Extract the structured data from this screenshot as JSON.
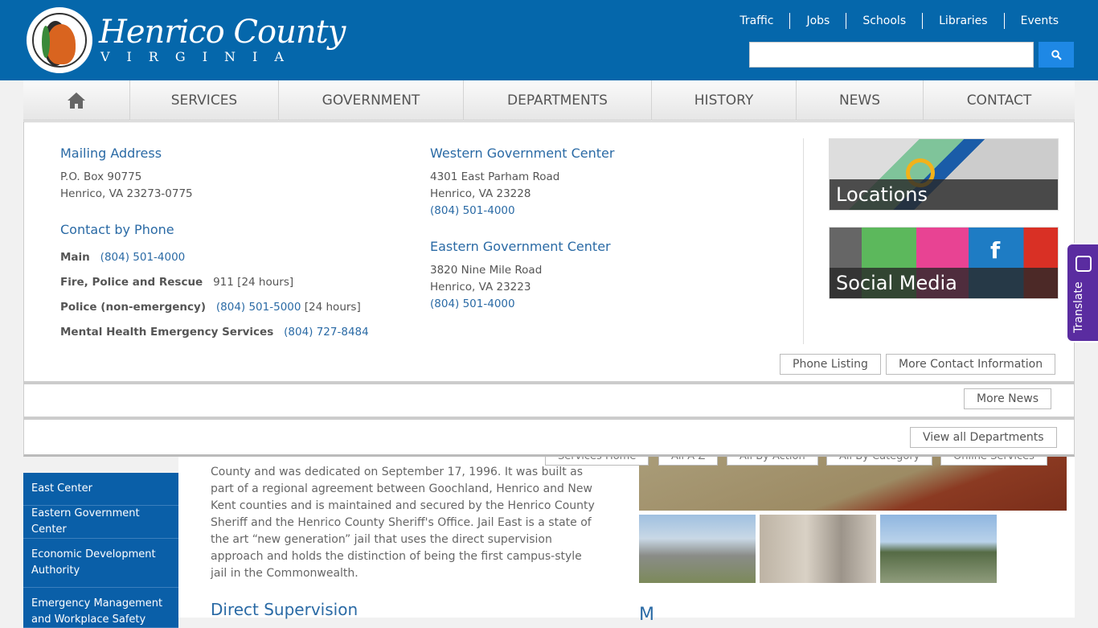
{
  "header": {
    "logo_title": "Henrico County",
    "logo_subtitle": "VIRGINIA",
    "seal_text": "County of Henrico, Virginia",
    "top_links": [
      "Traffic",
      "Jobs",
      "Schools",
      "Libraries",
      "Events"
    ],
    "search_placeholder": "",
    "search_icon": "search-icon"
  },
  "nav": {
    "home_icon": "home-icon",
    "items": [
      "SERVICES",
      "GOVERNMENT",
      "DEPARTMENTS",
      "HISTORY",
      "NEWS",
      "CONTACT"
    ]
  },
  "contact": {
    "mailing": {
      "title": "Mailing Address",
      "line1": "P.O. Box 90775",
      "line2": "Henrico, VA 23273-0775"
    },
    "phone": {
      "title": "Contact by Phone",
      "rows": [
        {
          "label": "Main",
          "number": "(804) 501-4000",
          "note": ""
        },
        {
          "label": "Fire, Police and Rescue",
          "number": "911",
          "note": "[24 hours]"
        },
        {
          "label": "Police (non-emergency)",
          "number": "(804) 501-5000",
          "note": "[24 hours]"
        },
        {
          "label": "Mental Health Emergency Services",
          "number": "(804) 727-8484",
          "note": ""
        }
      ]
    },
    "western": {
      "title": "Western Government Center",
      "line1": "4301 East Parham Road",
      "line2": "Henrico, VA 23228",
      "phone": "(804) 501-4000"
    },
    "eastern": {
      "title": "Eastern Government Center",
      "line1": "3820 Nine Mile Road",
      "line2": "Henrico, VA 23223",
      "phone": "(804) 501-4000"
    },
    "tiles": [
      "Locations",
      "Social Media"
    ],
    "buttons": [
      "Phone Listing",
      "More Contact Information"
    ]
  },
  "news": {
    "more_button": "More News"
  },
  "departments": {
    "view_all_button": "View all Departments"
  },
  "services_buttons": [
    "Services Home",
    "All A-Z",
    "All By Action",
    "All By Category",
    "Online Services"
  ],
  "sidebar": [
    "East Center",
    "Eastern Government Center",
    "Economic Development Authority",
    "Emergency Management and Workplace Safety"
  ],
  "main": {
    "text": "County and was dedicated on September 17, 1996. It was built as part of a regional agreement between Goochland, Henrico and New Kent counties and is maintained and secured by the Henrico County Sheriff and the Henrico County Sheriff's Office. Jail East is a state of the art “new generation” jail that uses the direct supervision approach and holds the distinction of being the first campus-style jail in the Commonwealth.",
    "heading": "Direct Supervision",
    "heading_right": "M"
  },
  "translate": {
    "label": "Translate"
  },
  "colors": {
    "header": "#0567ab",
    "link": "#2a6aa5",
    "sidebar": "#0a5fa8",
    "translate": "#5a2ca0"
  }
}
